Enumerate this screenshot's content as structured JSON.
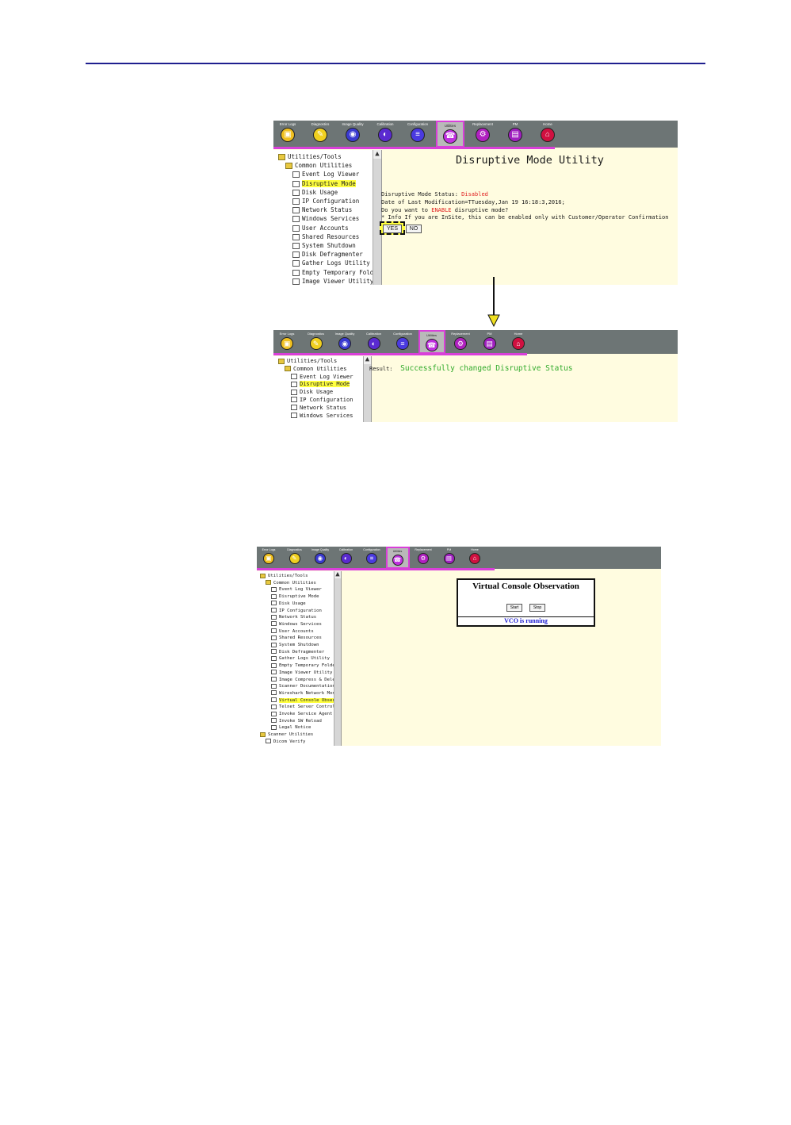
{
  "toolbar": {
    "buttons": [
      {
        "label": "Error Logs",
        "color": "#f0c020",
        "glyph": "▣"
      },
      {
        "label": "Diagnostics",
        "color": "#f0d020",
        "glyph": "✎"
      },
      {
        "label": "Image Quality",
        "color": "#3a3ad0",
        "glyph": "◉"
      },
      {
        "label": "Calibration",
        "color": "#5a2ad0",
        "glyph": "◐"
      },
      {
        "label": "Configuration",
        "color": "#4a3ae0",
        "glyph": "≡"
      },
      {
        "label": "Utilities",
        "color": "#c030e0",
        "glyph": "☎"
      },
      {
        "label": "Replacement",
        "color": "#b020c0",
        "glyph": "⚙"
      },
      {
        "label": "PM",
        "color": "#a020c0",
        "glyph": "▤"
      },
      {
        "label": "Home",
        "color": "#d01040",
        "glyph": "⌂"
      }
    ],
    "active_label": "Utilities"
  },
  "tree": {
    "root": "Utilities/Tools",
    "group": "Common Utilities",
    "items_top": [
      "Event Log Viewer",
      "Disruptive Mode",
      "Disk Usage",
      "IP Configuration",
      "Network Status",
      "Windows Services",
      "User Accounts",
      "Shared Resources",
      "System Shutdown",
      "Disk Defragmenter",
      "Gather Logs Utility",
      "Empty Temporary Folder",
      "Image Viewer Utility"
    ],
    "items_middle": [
      "Event Log Viewer",
      "Disruptive Mode",
      "Disk Usage",
      "IP Configuration",
      "Network Status",
      "Windows Services"
    ],
    "items_bottom": [
      "Event Log Viewer",
      "Disruptive Mode",
      "Disk Usage",
      "IP Configuration",
      "Network Status",
      "Windows Services",
      "User Accounts",
      "Shared Resources",
      "System Shutdown",
      "Disk Defragmenter",
      "Gather Logs Utility",
      "Empty Temporary Folder",
      "Image Viewer Utility",
      "Image Compress & Delete",
      "Scanner Documentation",
      "Wireshark Network Monitor",
      "Virtual Console Observation",
      "Telnet Server Control",
      "Invoke Service Agent P",
      "Invoke SW Reload",
      "Legal Notice"
    ],
    "group2": "Scanner Utilities",
    "item_dicom": "Dicom Verify",
    "selected_top": "Disruptive Mode",
    "selected_bottom": "Virtual Console Observation"
  },
  "disruptive": {
    "title": "Disruptive Mode Utility",
    "status_label": "Disruptive Mode Status:",
    "status_value": "Disabled",
    "date_line": "Date of Last Modification=TTuesday,Jan 19 16:18:3,2016;",
    "question_prefix": "Do you want to",
    "question_enable": "ENABLE",
    "question_suffix": "disruptive mode?",
    "info_line": "* Info If you are InSite, this can be enabled only with Customer/Operator Confirmation",
    "yes_label": "YES",
    "no_label": "NO"
  },
  "result": {
    "label": "Result:",
    "message": "Successfully changed Disruptive Status"
  },
  "vco": {
    "title": "Virtual Console Observation",
    "start_label": "Start",
    "stop_label": "Stop",
    "status": "VCO is running"
  },
  "colors": {
    "accent": "#d93fd9",
    "highlight": "#ffff40",
    "panel_bg": "#fffce0",
    "toolbar_bg": "#6d7575",
    "red": "#e02020",
    "green": "#2faa2a",
    "blue_status": "#1a1ad0"
  }
}
